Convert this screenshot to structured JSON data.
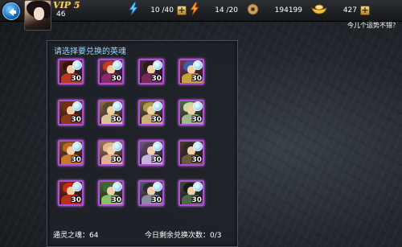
{
  "player": {
    "vip": "VIP 5",
    "level": "46"
  },
  "resources": {
    "stamina": "10 /40",
    "energy": "14 /20",
    "coins": "194199",
    "gold": "427"
  },
  "fortune_text": "今儿个运势不错？",
  "panel": {
    "title": "请选择要兑换的英魂"
  },
  "heroes": [
    {
      "count": "30",
      "hair": "#3a1208",
      "body": "#b8392a",
      "bg": "#5b2a2a"
    },
    {
      "count": "30",
      "hair": "#c43a1e",
      "body": "#8a2a6a",
      "bg": "#6a3350"
    },
    {
      "count": "30",
      "hair": "#2a1a18",
      "body": "#7a2a5a",
      "bg": "#4a2a4a"
    },
    {
      "count": "30",
      "hair": "#3a60a8",
      "body": "#c7a23a",
      "bg": "#7a3a4a"
    },
    {
      "count": "30",
      "hair": "#7a2a10",
      "body": "#8a3a1a",
      "bg": "#6a3a2a"
    },
    {
      "count": "30",
      "hair": "#5a4a2a",
      "body": "#d8c49a",
      "bg": "#8a7050"
    },
    {
      "count": "30",
      "hair": "#a89a4a",
      "body": "#c8b27a",
      "bg": "#6a6040"
    },
    {
      "count": "30",
      "hair": "#c8d8a0",
      "body": "#a0b890",
      "bg": "#506a4a"
    },
    {
      "count": "30",
      "hair": "#b86a1a",
      "body": "#c87a2a",
      "bg": "#7a4a2a"
    },
    {
      "count": "30",
      "hair": "#e0b890",
      "body": "#e0b090",
      "bg": "#a07a60"
    },
    {
      "count": "30",
      "hair": "#5a3a5a",
      "body": "#c8b0d8",
      "bg": "#6a5a7a"
    },
    {
      "count": "30",
      "hair": "#2a2a2a",
      "body": "#6a5a3a",
      "bg": "#4a3a2a"
    },
    {
      "count": "30",
      "hair": "#c82a1a",
      "body": "#b8301a",
      "bg": "#6a2a1a"
    },
    {
      "count": "30",
      "hair": "#3a6a3a",
      "body": "#8ac06a",
      "bg": "#4a6a3a"
    },
    {
      "count": "30",
      "hair": "#2a2a3a",
      "body": "#8a8aa0",
      "bg": "#5a5a6a"
    },
    {
      "count": "30",
      "hair": "#1a1a1a",
      "body": "#4a6a4a",
      "bg": "#3a4a3a"
    }
  ],
  "footer": {
    "soul_label": "通灵之魂：64",
    "exchange_label": "今日剩余兑换次数：0/3"
  },
  "colors": {
    "title_blue": "#9ad8ff",
    "rare_border": "#b24dd6"
  }
}
